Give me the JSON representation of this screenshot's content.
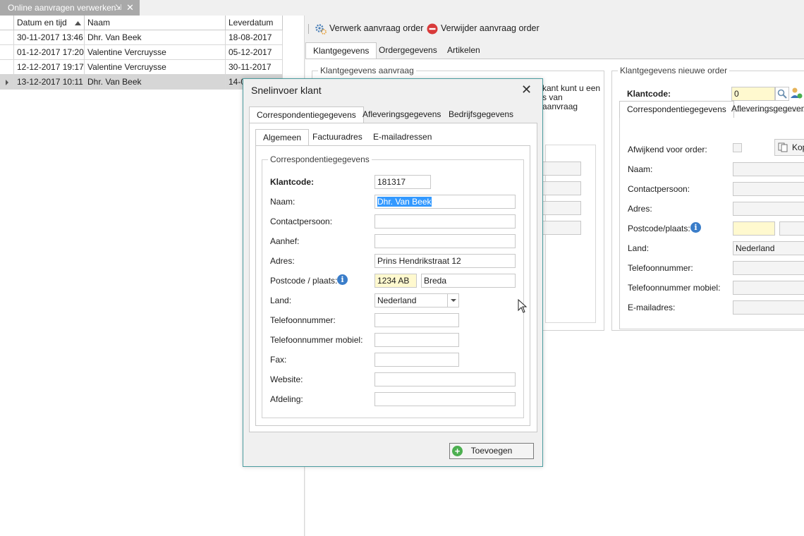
{
  "doc_tab": {
    "title": "Online aanvragen verwerken",
    "pin": "⇲",
    "close": "✕"
  },
  "grid": {
    "columns": [
      "Datum en tijd",
      "Naam",
      "Leverdatum"
    ],
    "rows": [
      {
        "datum": "30-11-2017 13:46",
        "naam": "Dhr. Van Beek",
        "lever": "18-08-2017"
      },
      {
        "datum": "01-12-2017 17:20",
        "naam": "Valentine Vercruysse",
        "lever": "05-12-2017"
      },
      {
        "datum": "12-12-2017 19:17",
        "naam": "Valentine Vercruysse",
        "lever": "30-11-2017"
      },
      {
        "datum": "13-12-2017 10:11",
        "naam": "Dhr. Van Beek",
        "lever": "14-0"
      }
    ]
  },
  "toolbar": {
    "process_label": "Verwerk aanvraag order",
    "delete_label": "Verwijder aanvraag order"
  },
  "main_tabs": [
    "Klantgegevens",
    "Ordergegevens",
    "Artikelen"
  ],
  "aanvraag": {
    "title": "Klantgegevens aanvraag",
    "text_lines": [
      "kant kunt u een",
      "s van",
      "aanvraag"
    ]
  },
  "nieuwe_order": {
    "title": "Klantgegevens nieuwe order",
    "klantcode_label": "Klantcode:",
    "klantcode_value": "0",
    "tabs": [
      "Correspondentiegegevens",
      "Afleveringsgegevens"
    ],
    "afwijkend_label": "Afwijkend voor order:",
    "kopieer_label": "Kop",
    "labels": [
      "Naam:",
      "Contactpersoon:",
      "Adres:",
      "Postcode/plaats:",
      "Land:",
      "Telefoonnummer:",
      "Telefoonnummer mobiel:",
      "E-mailadres:"
    ],
    "land_value": "Nederland"
  },
  "dialog": {
    "title": "Snelinvoer klant",
    "close": "✕",
    "tabs": [
      "Correspondentiegegevens",
      "Afleveringsgegevens",
      "Bedrijfsgegevens"
    ],
    "subtabs": [
      "Algemeen",
      "Factuuradres",
      "E-mailadressen"
    ],
    "group_title": "Correspondentiegegevens",
    "fields": {
      "klantcode_label": "Klantcode:",
      "klantcode": "181317",
      "naam_label": "Naam:",
      "naam": "Dhr. Van Beek",
      "contact_label": "Contactpersoon:",
      "contact": "",
      "aanhef_label": "Aanhef:",
      "aanhef": "",
      "adres_label": "Adres:",
      "adres": "Prins Hendrikstraat 12",
      "postcode_label": "Postcode / plaats:",
      "postcode": "1234 AB",
      "plaats": "Breda",
      "land_label": "Land:",
      "land": "Nederland",
      "tel_label": "Telefoonnummer:",
      "tel": "",
      "mobiel_label": "Telefoonnummer mobiel:",
      "mobiel": "",
      "fax_label": "Fax:",
      "fax": "",
      "website_label": "Website:",
      "website": "",
      "afdeling_label": "Afdeling:",
      "afdeling": ""
    },
    "add_label": "Toevoegen"
  }
}
